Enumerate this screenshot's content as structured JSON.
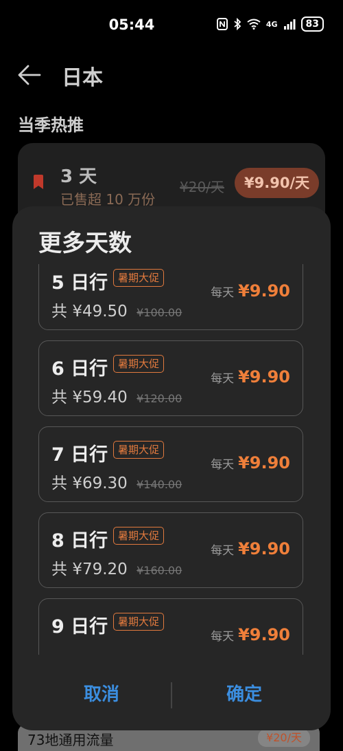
{
  "status_bar": {
    "time": "05:44",
    "network": "4G",
    "battery": "83"
  },
  "header": {
    "title": "日本"
  },
  "section": {
    "title": "当季热推"
  },
  "background_card": {
    "days": "3 天",
    "sold": "已售超 10 万份",
    "old_price": "¥20/天",
    "price": "¥9.90/天"
  },
  "bottom_item": {
    "name": "73地通用流量",
    "price": "¥20/天"
  },
  "dialog": {
    "title": "更多天数",
    "cancel_label": "取消",
    "confirm_label": "确定",
    "options": [
      {
        "days": "5 日行",
        "badge": "暑期大促",
        "total_prefix": "共",
        "total": "¥49.50",
        "old_total": "¥100.00",
        "daily_label": "每天",
        "daily_price": "¥9.90"
      },
      {
        "days": "6 日行",
        "badge": "暑期大促",
        "total_prefix": "共",
        "total": "¥59.40",
        "old_total": "¥120.00",
        "daily_label": "每天",
        "daily_price": "¥9.90"
      },
      {
        "days": "7 日行",
        "badge": "暑期大促",
        "total_prefix": "共",
        "total": "¥69.30",
        "old_total": "¥140.00",
        "daily_label": "每天",
        "daily_price": "¥9.90"
      },
      {
        "days": "8 日行",
        "badge": "暑期大促",
        "total_prefix": "共",
        "total": "¥79.20",
        "old_total": "¥160.00",
        "daily_label": "每天",
        "daily_price": "¥9.90"
      },
      {
        "days": "9 日行",
        "badge": "暑期大促",
        "total_prefix": "共",
        "total": "",
        "old_total": "",
        "daily_label": "每天",
        "daily_price": "¥9.90"
      }
    ]
  },
  "colors": {
    "accent": "#ef7f3a",
    "link": "#3b8ee0",
    "dialog_bg": "#262626"
  }
}
